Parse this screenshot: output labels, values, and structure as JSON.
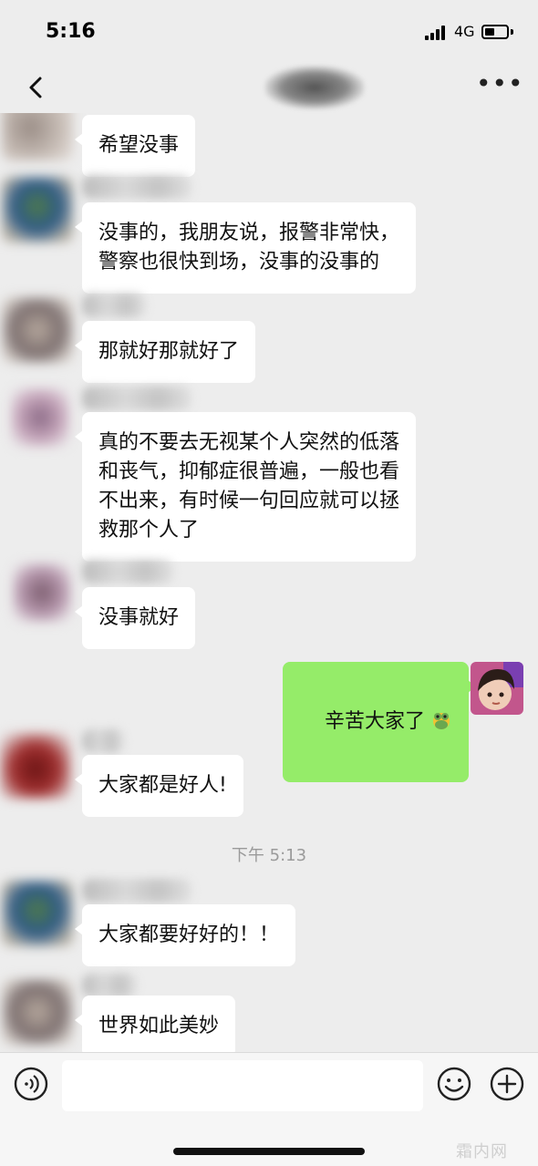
{
  "status_bar": {
    "time": "5:16",
    "network": "4G"
  },
  "messages": [
    {
      "sender": "other",
      "text": "希望没事"
    },
    {
      "sender": "other",
      "text": "没事的，我朋友说，报警非常快，\n警察也很快到场，没事的没事的"
    },
    {
      "sender": "other",
      "text": "那就好那就好了"
    },
    {
      "sender": "other",
      "text": "真的不要去无视某个人突然的低落\n和丧气，抑郁症很普遍，一般也看\n不出来，有时候一句回应就可以拯\n救那个人了"
    },
    {
      "sender": "other",
      "text": "没事就好"
    },
    {
      "sender": "self",
      "text": "辛苦大家了",
      "emoji": "frog-emoji-icon"
    },
    {
      "sender": "other",
      "text": "大家都是好人!"
    },
    {
      "sender": "other",
      "text": "大家都要好好的！！"
    },
    {
      "sender": "other",
      "text": "世界如此美妙"
    }
  ],
  "timestamp": "下午 5:13",
  "input_bar": {
    "value": "",
    "placeholder": ""
  },
  "watermark": "霜内网",
  "icons": [
    "back-chevron-icon",
    "more-dots-icon",
    "voice-icon",
    "emoji-face-icon",
    "plus-circle-icon"
  ],
  "colors": {
    "background": "#ededed",
    "self_bubble": "#95ec69",
    "other_bubble": "#ffffff"
  }
}
